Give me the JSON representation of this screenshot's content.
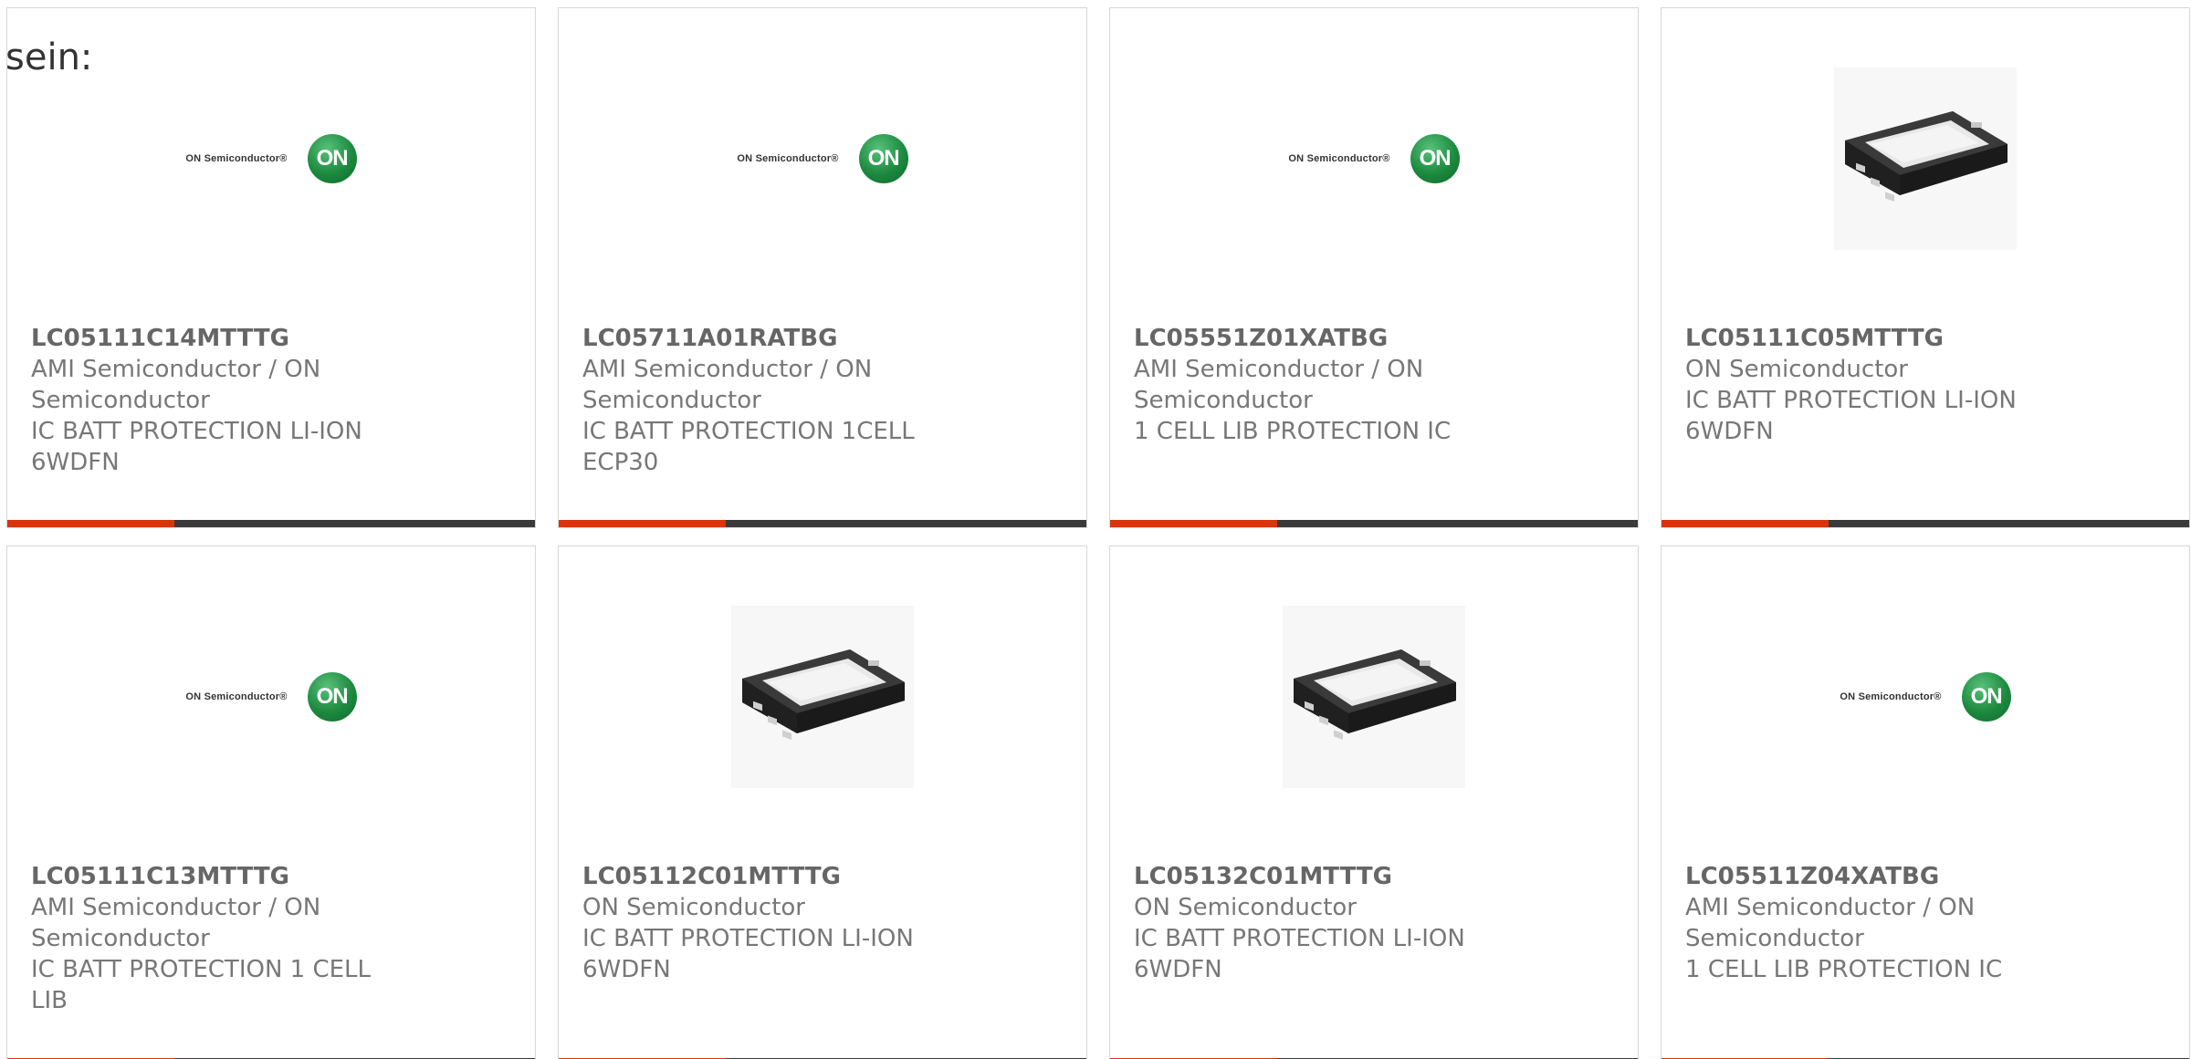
{
  "intro_text": "sein:",
  "colors": {
    "accent": "#d9350a",
    "bar": "#3a3a3a",
    "text": "#777777",
    "on_logo_green": "#1c8a3f"
  },
  "cards": [
    {
      "part_number": "LC05111C14MTTTG",
      "manufacturer": "AMI Semiconductor / ON Semiconductor",
      "description": "IC BATT PROTECTION LI-ION 6WDFN",
      "image": "on-semiconductor-logo",
      "logo_text": "ON Semiconductor®",
      "logo_mark": "ON"
    },
    {
      "part_number": "LC05711A01RATBG",
      "manufacturer": "AMI Semiconductor / ON Semiconductor",
      "description": "IC BATT PROTECTION 1CELL ECP30",
      "image": "on-semiconductor-logo",
      "logo_text": "ON Semiconductor®",
      "logo_mark": "ON"
    },
    {
      "part_number": "LC05551Z01XATBG",
      "manufacturer": "AMI Semiconductor / ON Semiconductor",
      "description": "1 CELL LIB PROTECTION IC",
      "image": "on-semiconductor-logo",
      "logo_text": "ON Semiconductor®",
      "logo_mark": "ON"
    },
    {
      "part_number": "LC05111C05MTTTG",
      "manufacturer": "ON Semiconductor",
      "description": "IC BATT PROTECTION LI-ION 6WDFN",
      "image": "wdfn-chip-photo"
    },
    {
      "part_number": "LC05111C13MTTTG",
      "manufacturer": "AMI Semiconductor / ON Semiconductor",
      "description": "IC BATT PROTECTION 1 CELL LIB",
      "image": "on-semiconductor-logo",
      "logo_text": "ON Semiconductor®",
      "logo_mark": "ON"
    },
    {
      "part_number": "LC05112C01MTTTG",
      "manufacturer": "ON Semiconductor",
      "description": "IC BATT PROTECTION LI-ION 6WDFN",
      "image": "wdfn-chip-photo"
    },
    {
      "part_number": "LC05132C01MTTTG",
      "manufacturer": "ON Semiconductor",
      "description": "IC BATT PROTECTION LI-ION 6WDFN",
      "image": "wdfn-chip-photo"
    },
    {
      "part_number": "LC05511Z04XATBG",
      "manufacturer": "AMI Semiconductor / ON Semiconductor",
      "description": "1 CELL LIB PROTECTION IC",
      "image": "on-semiconductor-logo",
      "logo_text": "ON Semiconductor®",
      "logo_mark": "ON"
    }
  ]
}
